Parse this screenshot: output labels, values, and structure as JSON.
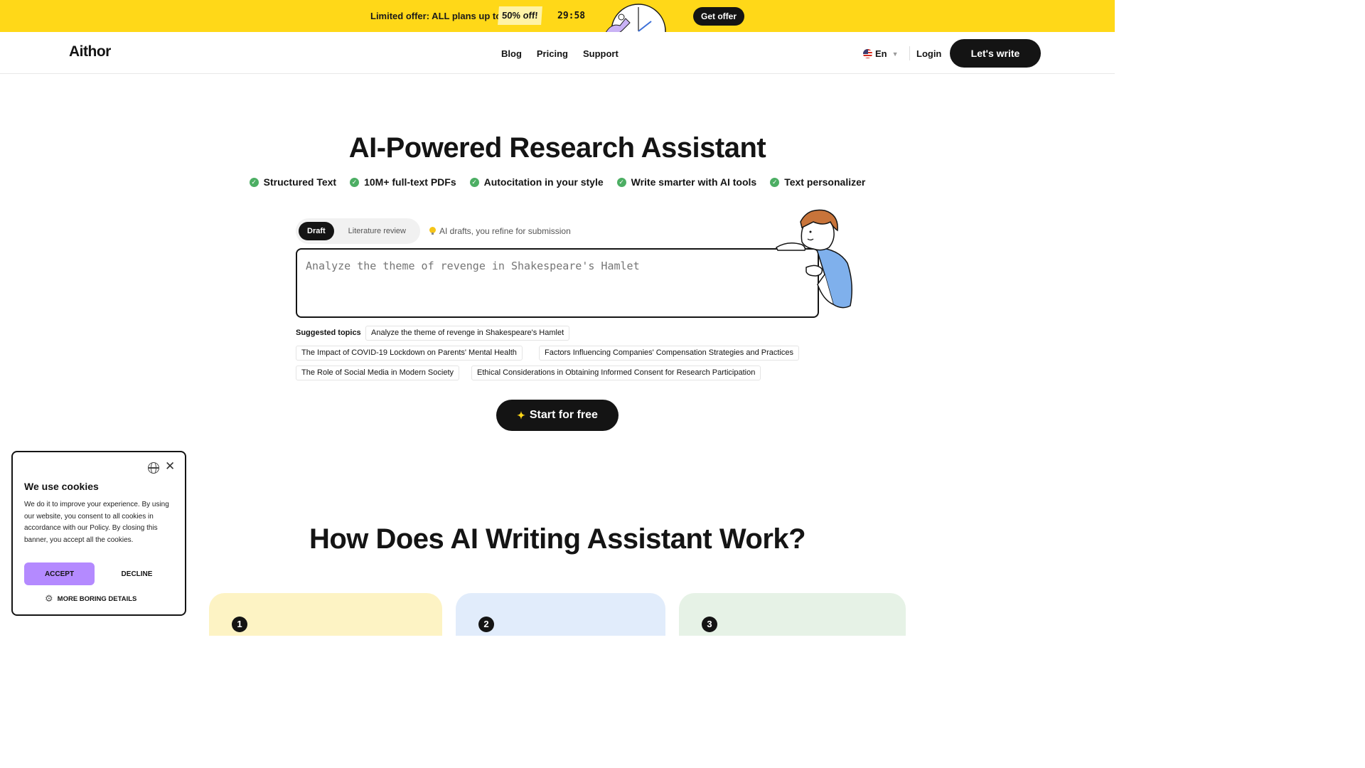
{
  "promo": {
    "text": "Limited offer: ALL plans up to",
    "badge": "50% off!",
    "timer": "29:58",
    "cta": "Get offer"
  },
  "header": {
    "logo": "Aithor",
    "nav": [
      "Blog",
      "Pricing",
      "Support"
    ],
    "language": "En",
    "login": "Login",
    "cta": "Let's write"
  },
  "hero": {
    "title": "AI-Powered Research Assistant",
    "features": [
      "Structured Text",
      "10M+ full-text PDFs",
      "Autocitation in your style",
      "Write smarter with AI tools",
      "Text personalizer"
    ],
    "modes": [
      "Draft",
      "Literature review"
    ],
    "active_mode": "Draft",
    "hint": "AI drafts, you refine for submission",
    "input_placeholder": "Analyze the theme of revenge in Shakespeare's Hamlet",
    "suggested_label": "Suggested topics",
    "suggested_topics": [
      "Analyze the theme of revenge in Shakespeare's Hamlet",
      "The Impact of COVID-19 Lockdown on Parents' Mental Health",
      "Factors Influencing Companies' Compensation Strategies and Practices",
      "The Role of Social Media in Modern Society",
      "Ethical Considerations in Obtaining Informed Consent for Research Participation"
    ],
    "start_button": "Start for free"
  },
  "how": {
    "title": "How Does AI Writing Assistant Work?",
    "steps": [
      {
        "number": "1",
        "color": "#fdf3c4"
      },
      {
        "number": "2",
        "color": "#e1ecfb"
      },
      {
        "number": "3",
        "color": "#e6f2e6"
      }
    ]
  },
  "cookie": {
    "title": "We use cookies",
    "text": "We do it to improve your experience. By using our website, you consent to all cookies in accordance with our Policy. By closing this banner, you accept all the cookies.",
    "accept": "ACCEPT",
    "decline": "DECLINE",
    "details": "MORE BORING DETAILS"
  },
  "colors": {
    "promo_bg": "#ffd818",
    "dark": "#141414",
    "accept": "#b48aff",
    "check": "#4cae63"
  }
}
